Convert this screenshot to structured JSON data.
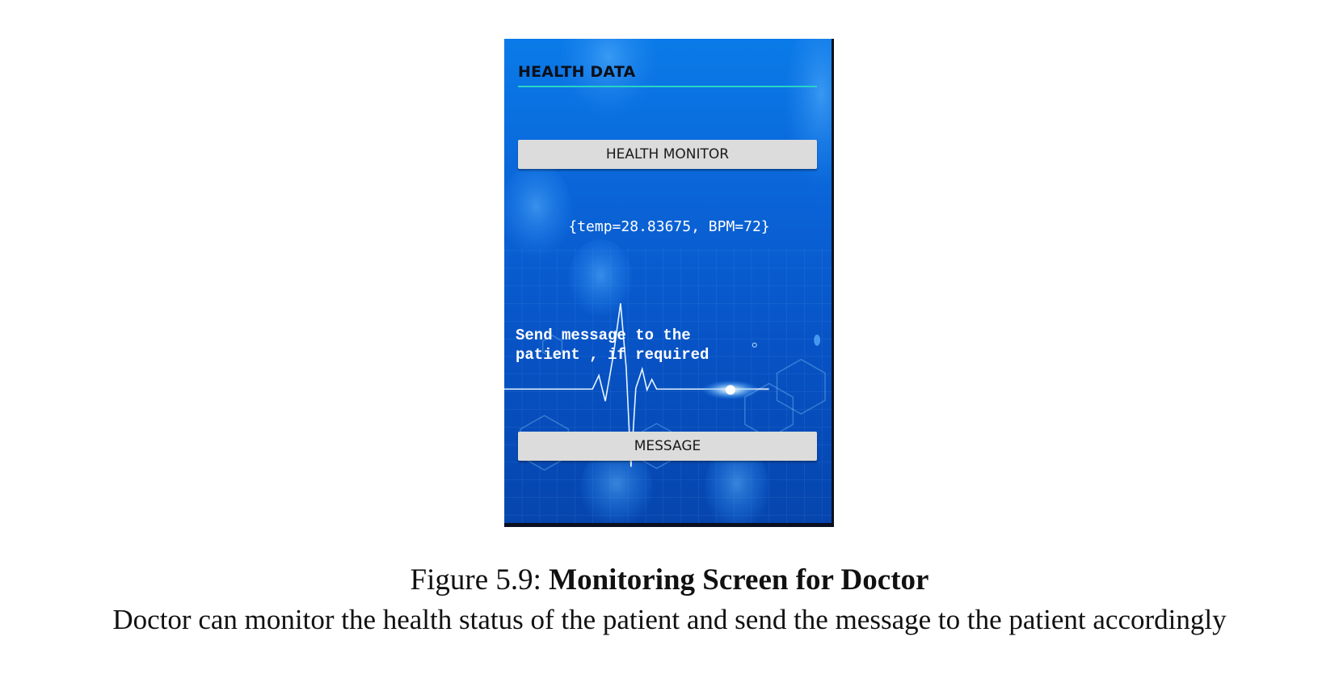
{
  "screen": {
    "title": "HEALTH DATA",
    "monitor_button_label": "HEALTH MONITOR",
    "health_readout": "{temp=28.83675, BPM=72}",
    "send_prompt": "Send message to the patient , if required",
    "message_button_label": "MESSAGE",
    "colors": {
      "background_top": "#0a7be8",
      "background_bottom": "#0645ad",
      "title_rule": "#27d3c6",
      "button": "#dcdcdc"
    }
  },
  "caption": {
    "label": "Figure 5.9:",
    "title": "Monitoring Screen for Doctor",
    "description": "Doctor can monitor the health status of the patient and send the message to the patient accordingly"
  }
}
